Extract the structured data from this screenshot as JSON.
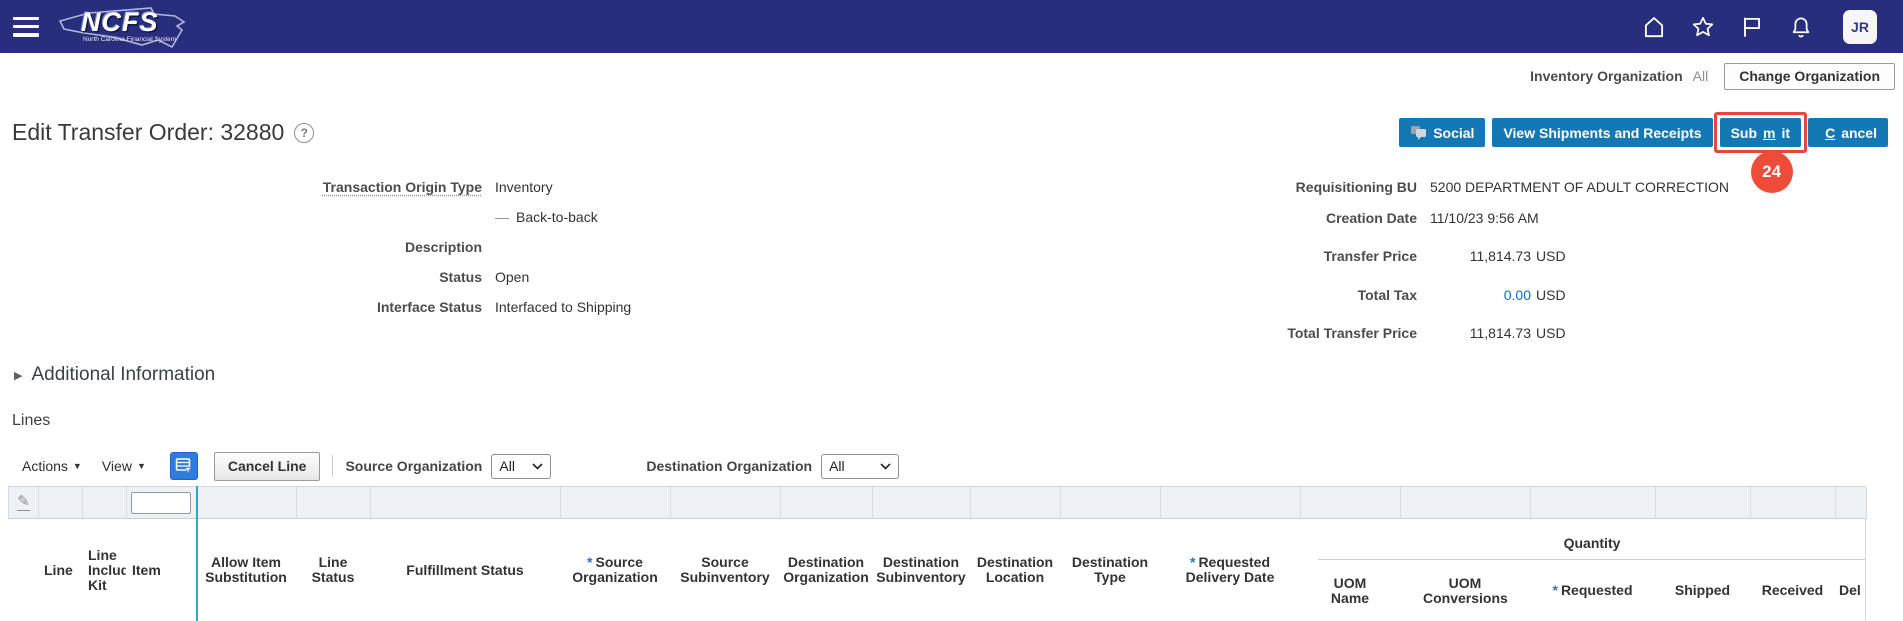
{
  "topbar": {
    "logo": {
      "acronym": "NCFS",
      "subtext": "North Carolina Financial System"
    },
    "icons": [
      "home",
      "favorites",
      "flag",
      "notifications"
    ],
    "avatar_initials": "JR"
  },
  "org_bar": {
    "label": "Inventory Organization",
    "value": "All",
    "change_button": "Change Organization"
  },
  "page": {
    "title": "Edit Transfer Order: 32880",
    "help_glyph": "?"
  },
  "actions": {
    "social": "Social",
    "view_shipments": "View Shipments and Receipts",
    "submit": {
      "pre": "Sub",
      "key": "m",
      "post": "it"
    },
    "cancel": {
      "pre": "",
      "key": "C",
      "post": "ancel"
    },
    "annotation_badge": "24"
  },
  "details": {
    "left": [
      {
        "label": "Transaction Origin Type",
        "value": "Inventory"
      },
      {
        "label": "",
        "dash": "—",
        "value": "Back-to-back"
      },
      {
        "label": "Description",
        "value": ""
      },
      {
        "label": "Status",
        "value": "Open"
      },
      {
        "label": "Interface Status",
        "value": "Interfaced to Shipping"
      }
    ],
    "right": [
      {
        "label": "Requisitioning BU",
        "value": "5200 DEPARTMENT OF ADULT CORRECTION"
      },
      {
        "label": "Creation Date",
        "value": "11/10/23 9:56 AM"
      },
      {
        "label": "Transfer Price",
        "amount": "11,814.73",
        "currency": "USD"
      },
      {
        "label": "Total Tax",
        "amount": "0.00",
        "currency": "USD"
      },
      {
        "label": "Total Transfer Price",
        "amount": "11,814.73",
        "currency": "USD"
      }
    ]
  },
  "sections": {
    "additional_information": "Additional Information",
    "lines": "Lines"
  },
  "toolbar": {
    "actions": "Actions",
    "view": "View",
    "cancel_line": "Cancel Line",
    "source_org_label": "Source Organization",
    "source_org_value": "All",
    "dest_org_label": "Destination Organization",
    "dest_org_value": "All"
  },
  "table": {
    "required_marker": "*",
    "filter": {
      "item_filter_value": ""
    },
    "columns": [
      {
        "label": "Line"
      },
      {
        "label": "Line Including Kit"
      },
      {
        "label": "Item"
      },
      {
        "label": "Allow Item Substitution"
      },
      {
        "label": "Line Status"
      },
      {
        "label": "Fulfillment Status"
      },
      {
        "label": "Source Organization",
        "required": true
      },
      {
        "label": "Source Subinventory"
      },
      {
        "label": "Destination Organization"
      },
      {
        "label": "Destination Subinventory"
      },
      {
        "label": "Destination Location"
      },
      {
        "label": "Destination Type"
      },
      {
        "label": "Requested Delivery Date",
        "required": true
      }
    ],
    "quantity_group": {
      "label": "Quantity",
      "columns": [
        {
          "label": "UOM Name"
        },
        {
          "label": "UOM Conversions"
        },
        {
          "label": "Requested",
          "required": true
        },
        {
          "label": "Shipped"
        },
        {
          "label": "Received"
        },
        {
          "label": "Del"
        }
      ]
    }
  },
  "colors": {
    "navbar_blue": "#292e7c",
    "button_blue": "#1478b5",
    "annotation_red": "#e8463c",
    "badge_red": "#ee4b38",
    "link_blue": "#0b6fc4",
    "teal_divider": "#2aa9c2",
    "filter_row_bg": "#eef1f5"
  }
}
